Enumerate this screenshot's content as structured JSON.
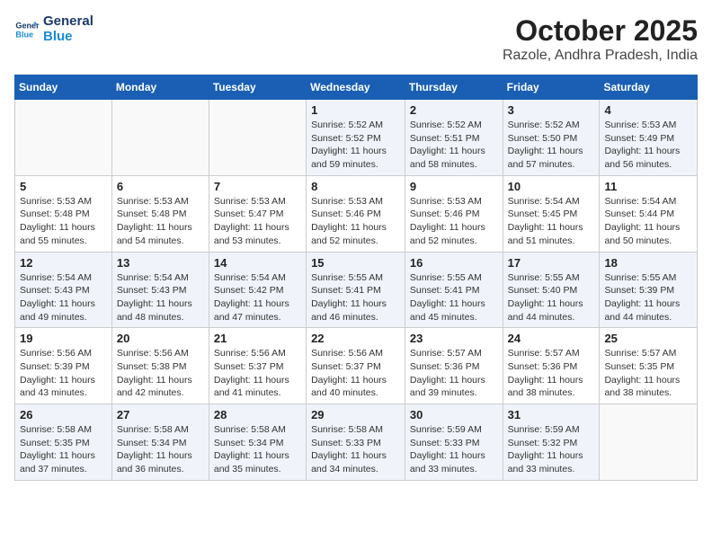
{
  "header": {
    "logo_line1": "General",
    "logo_line2": "Blue",
    "title": "October 2025",
    "subtitle": "Razole, Andhra Pradesh, India"
  },
  "weekdays": [
    "Sunday",
    "Monday",
    "Tuesday",
    "Wednesday",
    "Thursday",
    "Friday",
    "Saturday"
  ],
  "weeks": [
    [
      {
        "day": "",
        "info": ""
      },
      {
        "day": "",
        "info": ""
      },
      {
        "day": "",
        "info": ""
      },
      {
        "day": "1",
        "info": "Sunrise: 5:52 AM\nSunset: 5:52 PM\nDaylight: 11 hours and 59 minutes."
      },
      {
        "day": "2",
        "info": "Sunrise: 5:52 AM\nSunset: 5:51 PM\nDaylight: 11 hours and 58 minutes."
      },
      {
        "day": "3",
        "info": "Sunrise: 5:52 AM\nSunset: 5:50 PM\nDaylight: 11 hours and 57 minutes."
      },
      {
        "day": "4",
        "info": "Sunrise: 5:53 AM\nSunset: 5:49 PM\nDaylight: 11 hours and 56 minutes."
      }
    ],
    [
      {
        "day": "5",
        "info": "Sunrise: 5:53 AM\nSunset: 5:48 PM\nDaylight: 11 hours and 55 minutes."
      },
      {
        "day": "6",
        "info": "Sunrise: 5:53 AM\nSunset: 5:48 PM\nDaylight: 11 hours and 54 minutes."
      },
      {
        "day": "7",
        "info": "Sunrise: 5:53 AM\nSunset: 5:47 PM\nDaylight: 11 hours and 53 minutes."
      },
      {
        "day": "8",
        "info": "Sunrise: 5:53 AM\nSunset: 5:46 PM\nDaylight: 11 hours and 52 minutes."
      },
      {
        "day": "9",
        "info": "Sunrise: 5:53 AM\nSunset: 5:46 PM\nDaylight: 11 hours and 52 minutes."
      },
      {
        "day": "10",
        "info": "Sunrise: 5:54 AM\nSunset: 5:45 PM\nDaylight: 11 hours and 51 minutes."
      },
      {
        "day": "11",
        "info": "Sunrise: 5:54 AM\nSunset: 5:44 PM\nDaylight: 11 hours and 50 minutes."
      }
    ],
    [
      {
        "day": "12",
        "info": "Sunrise: 5:54 AM\nSunset: 5:43 PM\nDaylight: 11 hours and 49 minutes."
      },
      {
        "day": "13",
        "info": "Sunrise: 5:54 AM\nSunset: 5:43 PM\nDaylight: 11 hours and 48 minutes."
      },
      {
        "day": "14",
        "info": "Sunrise: 5:54 AM\nSunset: 5:42 PM\nDaylight: 11 hours and 47 minutes."
      },
      {
        "day": "15",
        "info": "Sunrise: 5:55 AM\nSunset: 5:41 PM\nDaylight: 11 hours and 46 minutes."
      },
      {
        "day": "16",
        "info": "Sunrise: 5:55 AM\nSunset: 5:41 PM\nDaylight: 11 hours and 45 minutes."
      },
      {
        "day": "17",
        "info": "Sunrise: 5:55 AM\nSunset: 5:40 PM\nDaylight: 11 hours and 44 minutes."
      },
      {
        "day": "18",
        "info": "Sunrise: 5:55 AM\nSunset: 5:39 PM\nDaylight: 11 hours and 44 minutes."
      }
    ],
    [
      {
        "day": "19",
        "info": "Sunrise: 5:56 AM\nSunset: 5:39 PM\nDaylight: 11 hours and 43 minutes."
      },
      {
        "day": "20",
        "info": "Sunrise: 5:56 AM\nSunset: 5:38 PM\nDaylight: 11 hours and 42 minutes."
      },
      {
        "day": "21",
        "info": "Sunrise: 5:56 AM\nSunset: 5:37 PM\nDaylight: 11 hours and 41 minutes."
      },
      {
        "day": "22",
        "info": "Sunrise: 5:56 AM\nSunset: 5:37 PM\nDaylight: 11 hours and 40 minutes."
      },
      {
        "day": "23",
        "info": "Sunrise: 5:57 AM\nSunset: 5:36 PM\nDaylight: 11 hours and 39 minutes."
      },
      {
        "day": "24",
        "info": "Sunrise: 5:57 AM\nSunset: 5:36 PM\nDaylight: 11 hours and 38 minutes."
      },
      {
        "day": "25",
        "info": "Sunrise: 5:57 AM\nSunset: 5:35 PM\nDaylight: 11 hours and 38 minutes."
      }
    ],
    [
      {
        "day": "26",
        "info": "Sunrise: 5:58 AM\nSunset: 5:35 PM\nDaylight: 11 hours and 37 minutes."
      },
      {
        "day": "27",
        "info": "Sunrise: 5:58 AM\nSunset: 5:34 PM\nDaylight: 11 hours and 36 minutes."
      },
      {
        "day": "28",
        "info": "Sunrise: 5:58 AM\nSunset: 5:34 PM\nDaylight: 11 hours and 35 minutes."
      },
      {
        "day": "29",
        "info": "Sunrise: 5:58 AM\nSunset: 5:33 PM\nDaylight: 11 hours and 34 minutes."
      },
      {
        "day": "30",
        "info": "Sunrise: 5:59 AM\nSunset: 5:33 PM\nDaylight: 11 hours and 33 minutes."
      },
      {
        "day": "31",
        "info": "Sunrise: 5:59 AM\nSunset: 5:32 PM\nDaylight: 11 hours and 33 minutes."
      },
      {
        "day": "",
        "info": ""
      }
    ]
  ]
}
